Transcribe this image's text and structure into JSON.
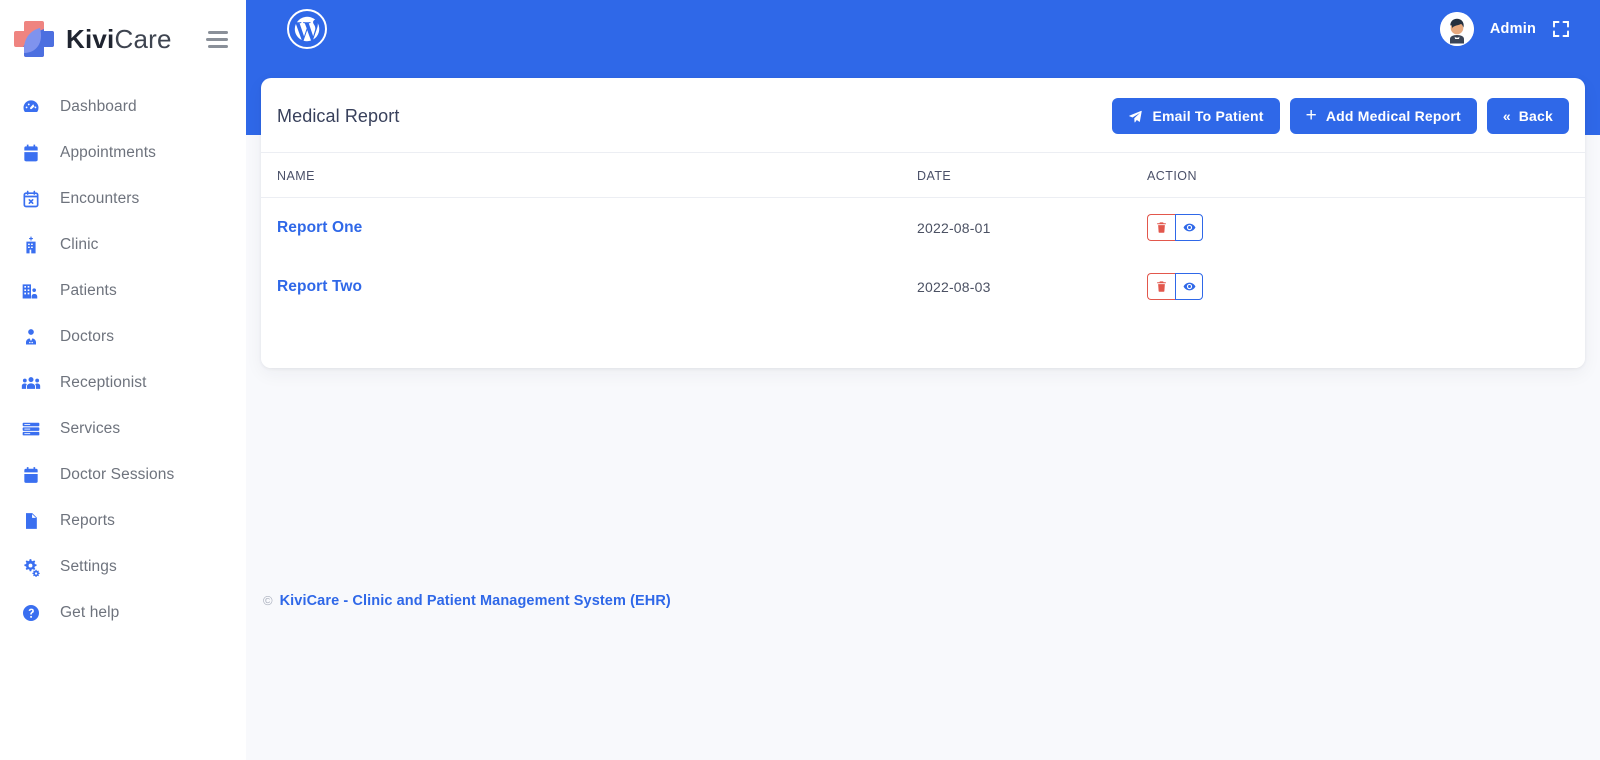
{
  "brand": {
    "name_bold": "Kivi",
    "name_light": "Care",
    "logo_icon": "kivicare-cross-logo",
    "menu_icon": "hamburger-menu-icon"
  },
  "sidebar": {
    "items": [
      {
        "label": "Dashboard",
        "icon": "speedometer-icon"
      },
      {
        "label": "Appointments",
        "icon": "calendar-icon"
      },
      {
        "label": "Encounters",
        "icon": "calendar-x-icon"
      },
      {
        "label": "Clinic",
        "icon": "hospital-building-icon"
      },
      {
        "label": "Patients",
        "icon": "building-people-icon"
      },
      {
        "label": "Doctors",
        "icon": "doctor-person-icon"
      },
      {
        "label": "Receptionist",
        "icon": "people-group-icon"
      },
      {
        "label": "Services",
        "icon": "server-list-icon"
      },
      {
        "label": "Doctor Sessions",
        "icon": "calendar-solid-icon"
      },
      {
        "label": "Reports",
        "icon": "document-page-icon"
      },
      {
        "label": "Settings",
        "icon": "gears-icon"
      },
      {
        "label": "Get help",
        "icon": "question-circle-icon"
      }
    ]
  },
  "topbar": {
    "site_icon": "wordpress-logo-icon",
    "user_name": "Admin",
    "avatar_icon": "user-avatar",
    "fullscreen_icon": "fullscreen-expand-icon",
    "bg_color": "#2f68e8"
  },
  "card": {
    "title": "Medical Report",
    "buttons": [
      {
        "label": "Email To Patient",
        "icon": "paper-plane-icon",
        "name": "email-to-patient-button"
      },
      {
        "label": "Add Medical Report",
        "icon": "plus-icon",
        "name": "add-medical-report-button"
      },
      {
        "label": "Back",
        "icon": "double-chevron-left-icon",
        "name": "back-button"
      }
    ],
    "table": {
      "columns": [
        "NAME",
        "DATE",
        "ACTION"
      ],
      "rows": [
        {
          "name": "Report One",
          "date": "2022-08-01",
          "delete_icon": "trash-icon",
          "view_icon": "eye-icon"
        },
        {
          "name": "Report Two",
          "date": "2022-08-03",
          "delete_icon": "trash-icon",
          "view_icon": "eye-icon"
        }
      ]
    }
  },
  "footer": {
    "copyright_symbol": "©",
    "text": "KiviCare - Clinic and Patient Management System (EHR)"
  },
  "colors": {
    "primary": "#2f68e8",
    "danger": "#e2574c",
    "page_bg": "#f8f9fc",
    "sidebar_icon": "#3a6ff0"
  }
}
